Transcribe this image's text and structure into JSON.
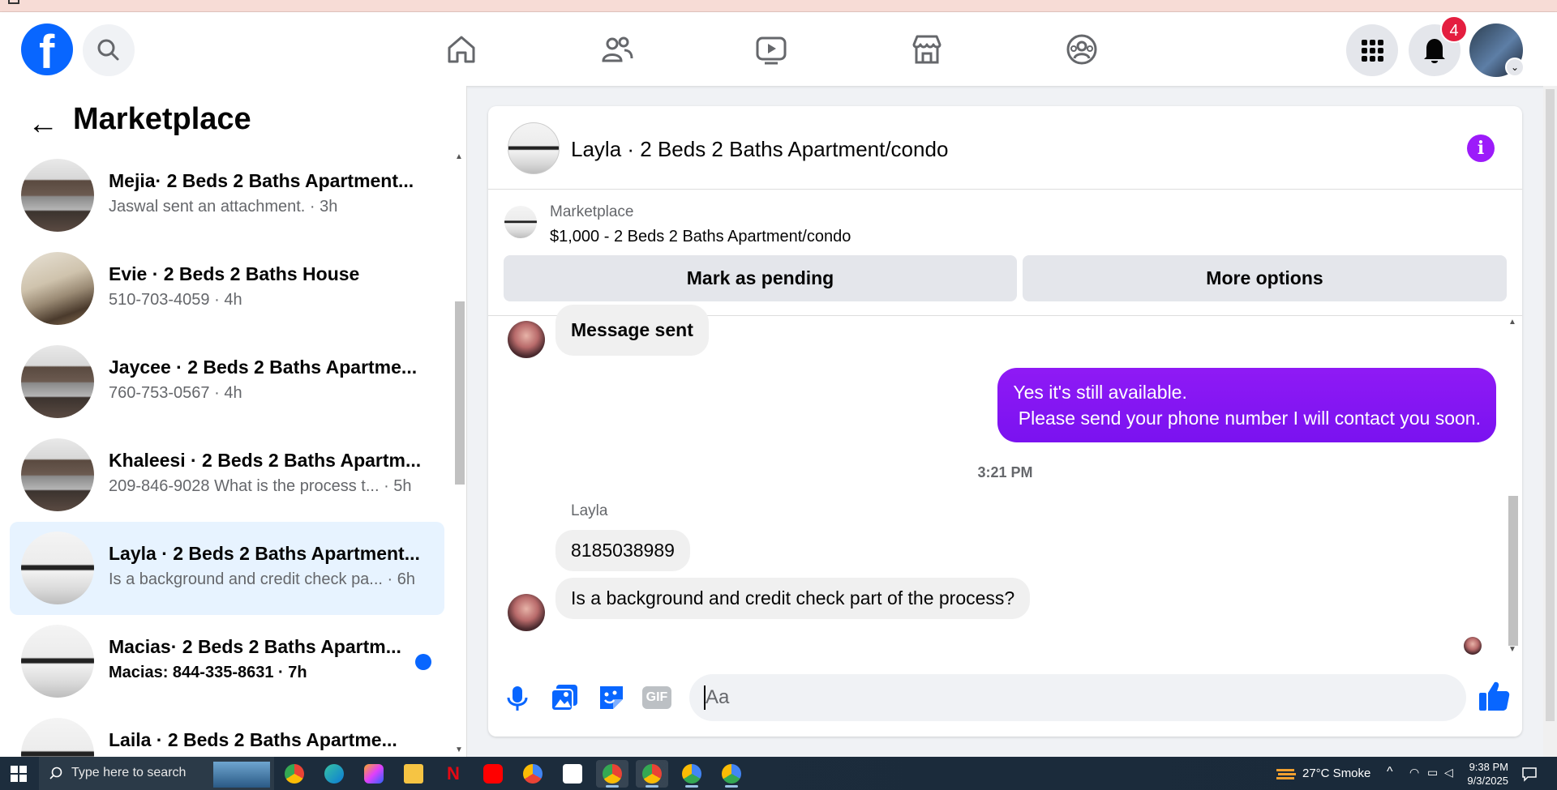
{
  "nav": {
    "logo_letter": "f",
    "notification_count": "4"
  },
  "sidebar": {
    "title": "Marketplace",
    "conversations": [
      {
        "title": "Mejia· 2 Beds 2 Baths Apartment...",
        "subtitle": "Jaswal sent an attachment. · 3h"
      },
      {
        "title": "Evie · 2 Beds 2 Baths House",
        "subtitle": "510-703-4059 · 4h"
      },
      {
        "title": "Jaycee · 2 Beds 2 Baths Apartme...",
        "subtitle": "760-753-0567 · 4h"
      },
      {
        "title": "Khaleesi · 2 Beds 2 Baths Apartm...",
        "subtitle": "209-846-9028 What is the process t...  · 5h"
      },
      {
        "title": "Layla · 2 Beds 2 Baths Apartment...",
        "subtitle": "Is a background and credit check pa... · 6h"
      },
      {
        "title": "Macias· 2 Beds 2 Baths Apartm...",
        "subtitle": "Macias: 844-335-8631 · 7h"
      },
      {
        "title": "Laila · 2 Beds 2 Baths Apartme...",
        "subtitle": ""
      }
    ]
  },
  "chat": {
    "title": "Layla · 2 Beds 2 Baths Apartment/condo",
    "marketplace_label": "Marketplace",
    "listing": "$1,000 - 2 Beds 2 Baths Apartment/condo",
    "mark_pending_label": "Mark as pending",
    "more_options_label": "More options",
    "messages": {
      "msg1": "Message sent",
      "outgoing": "Yes it's still available.\n Please send your phone number I will contact you soon.",
      "timestamp": "3:21 PM",
      "sender": "Layla",
      "msg2": "8185038989",
      "msg3": "Is a background and credit check part of the process?"
    },
    "composer_placeholder": "Aa",
    "gif_label": "GIF"
  },
  "taskbar": {
    "search_placeholder": "Type here to search",
    "weather": "27°C  Smoke",
    "time": "9:38 PM",
    "date": "9/3/2025"
  },
  "colors": {
    "brand_blue": "#0866ff",
    "messenger_purple": "#8a0ef2",
    "active_row": "#e7f3ff",
    "badge_red": "#e41e3f"
  }
}
